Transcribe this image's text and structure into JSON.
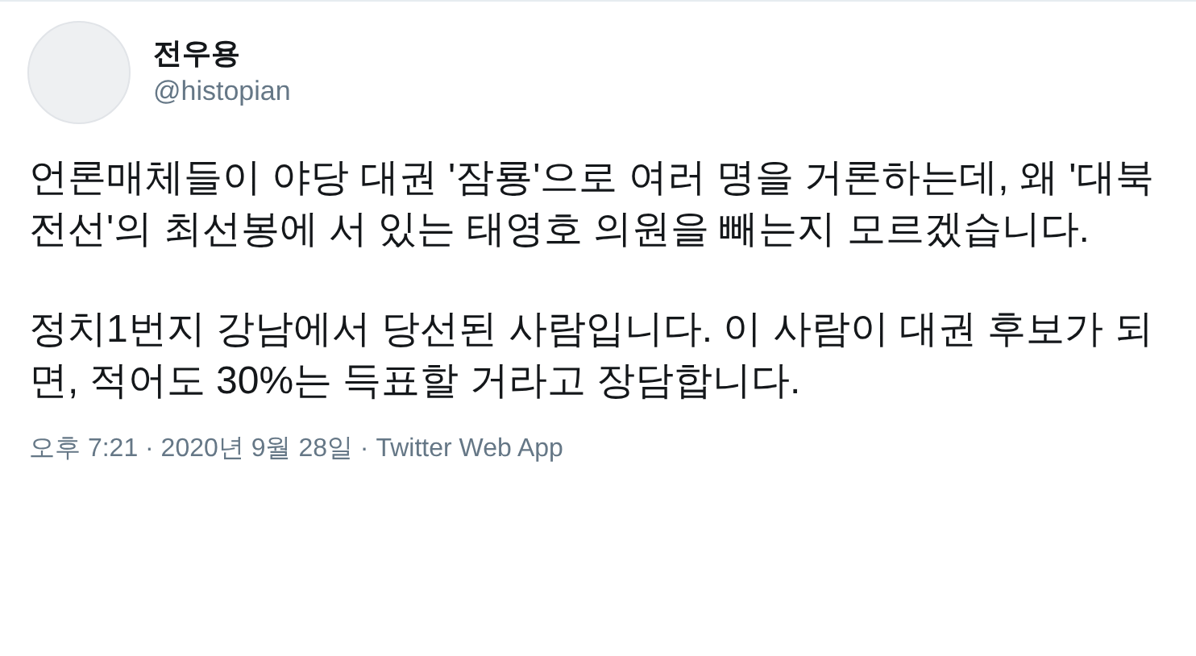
{
  "author": {
    "name": "전우용",
    "handle": "@histopian"
  },
  "paragraphs": [
    "언론매체들이 야당 대권 '잠룡'으로 여러 명을 거론하는데, 왜 '대북전선'의 최선봉에 서 있는 태영호 의원을 빼는지 모르겠습니다.",
    "정치1번지 강남에서 당선된 사람입니다. 이 사람이 대권 후보가 되면, 적어도 30%는 득표할 거라고 장담합니다."
  ],
  "meta": "오후 7:21 · 2020년 9월 28일 · Twitter Web App"
}
